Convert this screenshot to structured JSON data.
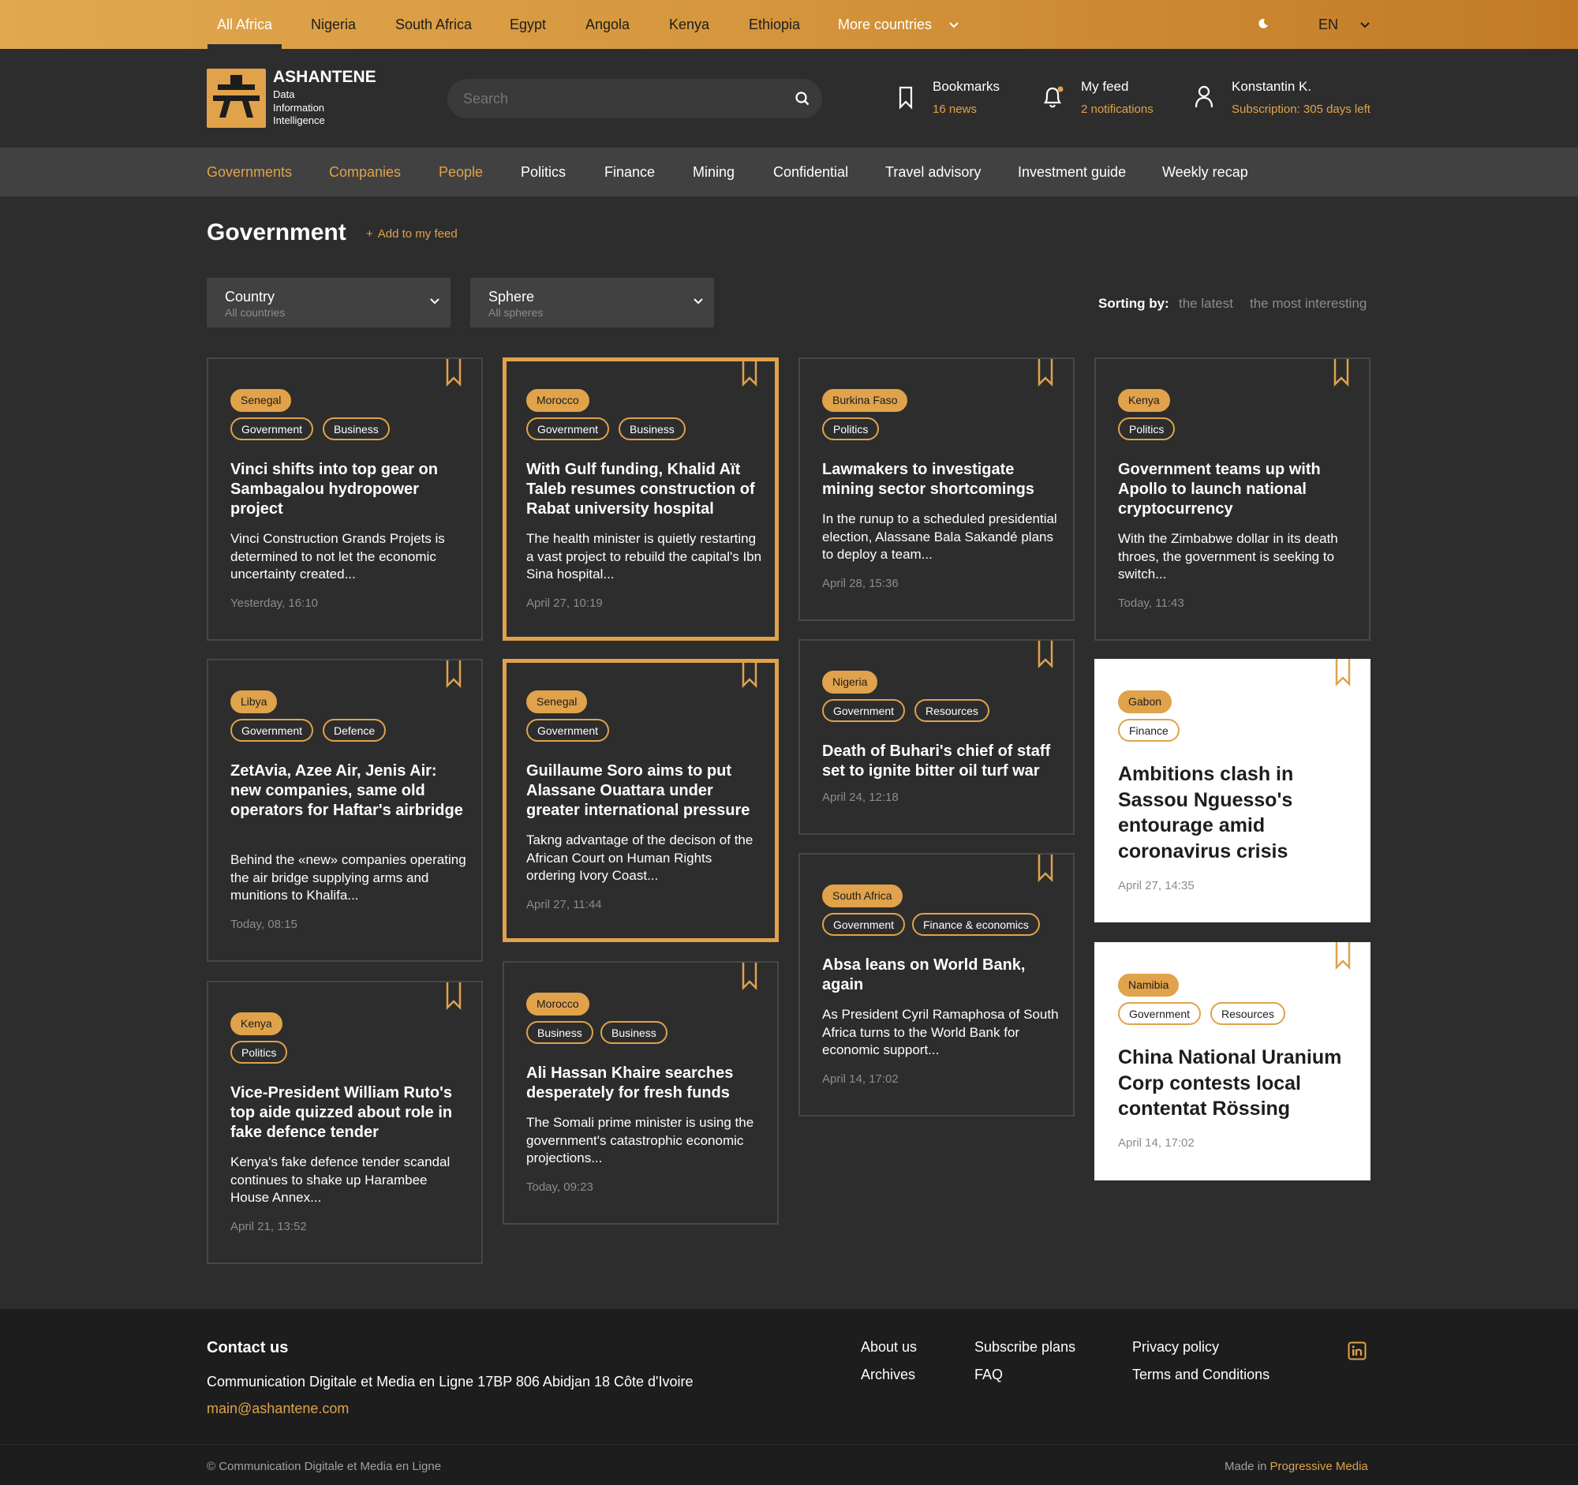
{
  "top_tabs": {
    "items": [
      "All Africa",
      "Nigeria",
      "South Africa",
      "Egypt",
      "Angola",
      "Kenya",
      "Ethiopia"
    ],
    "more_countries": "More countries",
    "language": "EN"
  },
  "brand": {
    "name": "ASHANTENE",
    "tagline": "Data\nInformation\nIntelligence"
  },
  "search": {
    "placeholder": "Search"
  },
  "header": {
    "bookmarks": {
      "title": "Bookmarks",
      "sub": "16 news"
    },
    "feed": {
      "title": "My feed",
      "sub": "2 notifications"
    },
    "user": {
      "title": "Konstantin K.",
      "sub": "Subscription: 305 days left"
    }
  },
  "nav": {
    "items": [
      "Governments",
      "Companies",
      "People",
      "Politics",
      "Finance",
      "Mining",
      "Confidential",
      "Travel advisory",
      "Investment guide",
      "Weekly recap"
    ],
    "highlighted": [
      "Governments",
      "Companies",
      "People"
    ]
  },
  "page": {
    "title": "Government",
    "add_feed": "Add to my feed"
  },
  "filters": {
    "country": {
      "label": "Country",
      "value": "All countries"
    },
    "sphere": {
      "label": "Sphere",
      "value": "All spheres"
    },
    "sorting_label": "Sorting by:",
    "sort_options": [
      "the latest",
      "the most interesting"
    ]
  },
  "cards": [
    {
      "country": "Senegal",
      "tags": [
        "Government",
        "Business"
      ],
      "title": "Vinci shifts into top gear on Sambagalou hydropower project",
      "excerpt": "Vinci Construction Grands Projets is determined to not let the economic uncertainty created...",
      "date": "Yesterday, 16:10"
    },
    {
      "country": "Morocco",
      "tags": [
        "Government",
        "Business"
      ],
      "title": "With Gulf funding, Khalid Aït Taleb resumes construction of Rabat university hospital",
      "excerpt": "The health minister is quietly restarting a vast project to rebuild the capital's Ibn Sina hospital...",
      "date": "April 27, 10:19"
    },
    {
      "country": "Burkina Faso",
      "tags": [
        "Politics"
      ],
      "title": "Lawmakers to investigate mining sector shortcomings",
      "excerpt": "In the runup to a scheduled presidential election, Alassane Bala Sakandé plans to deploy a team...",
      "date": "April 28, 15:36"
    },
    {
      "country": "Kenya",
      "tags": [
        "Politics"
      ],
      "title": "Government teams up with Apollo to launch national cryptocurrency",
      "excerpt": "With the Zimbabwe dollar in its death throes, the government is seeking to switch...",
      "date": "Today, 11:43"
    },
    {
      "country": "Libya",
      "tags": [
        "Government",
        "Defence"
      ],
      "title": "ZetAvia, Azee Air, Jenis Air: new companies, same old operators for Haftar's airbridge",
      "excerpt": "Behind the «new» companies operating the air bridge supplying arms and munitions to Khalifa...",
      "date": "Today, 08:15"
    },
    {
      "country": "Senegal",
      "tags": [
        "Government"
      ],
      "title": "Guillaume Soro aims to put Alassane Ouattara under greater international pressure",
      "excerpt": "Takng advantage of the decison of the African Court on Human Rights ordering Ivory Coast...",
      "date": "April 27, 11:44"
    },
    {
      "country": "Nigeria",
      "tags": [
        "Government",
        "Resources"
      ],
      "title": "Death of Buhari's chief of staff set to ignite bitter oil turf war",
      "excerpt": "",
      "date": "April 24, 12:18"
    },
    {
      "country": "Gabon",
      "tags": [
        "Finance"
      ],
      "title": "Ambitions clash in Sassou Nguesso's entourage amid coronavirus crisis",
      "excerpt": "",
      "date": "April 27, 14:35"
    },
    {
      "country": "South Africa",
      "tags": [
        "Government",
        "Finance & economics"
      ],
      "title": "Absa leans on World Bank, again",
      "excerpt": "As President Cyril Ramaphosa of South Africa turns to the World Bank for economic support...",
      "date": "April 14, 17:02"
    },
    {
      "country": "Kenya",
      "tags": [
        "Politics"
      ],
      "title": "Vice-President William Ruto's top aide quizzed about role in fake defence tender",
      "excerpt": "Kenya's fake defence tender scandal continues to shake up Harambee House Annex...",
      "date": "April 21, 13:52"
    },
    {
      "country": "Morocco",
      "tags": [
        "Business",
        "Business"
      ],
      "title": "Ali Hassan Khaire searches desperately for fresh funds",
      "excerpt": "The Somali prime minister is using the government's catastrophic economic projections...",
      "date": "Today, 09:23"
    },
    {
      "country": "Namibia",
      "tags": [
        "Government",
        "Resources"
      ],
      "title": "China National Uranium Corp contests local contentat Rössing",
      "excerpt": "",
      "date": "April 14, 17:02"
    }
  ],
  "footer": {
    "contact_title": "Contact us",
    "address": "Communication Digitale et Media en Ligne 17BP 806 Abidjan 18 Côte d'Ivoire",
    "email": "main@ashantene.com",
    "links": {
      "about": "About us",
      "archives": "Archives",
      "plans": "Subscribe plans",
      "faq": "FAQ",
      "privacy": "Privacy policy",
      "terms": "Terms and Conditions"
    },
    "social_icon": "linkedin-icon",
    "copyright": "© Communication Digitale et Media en Ligne",
    "made_in": "Made in",
    "made_by": "Progressive Media"
  },
  "colors": {
    "accent": "#e0a24a",
    "background": "#2d2d2d",
    "nav_bg": "#414141",
    "footer_bg": "#1d1d1d"
  }
}
